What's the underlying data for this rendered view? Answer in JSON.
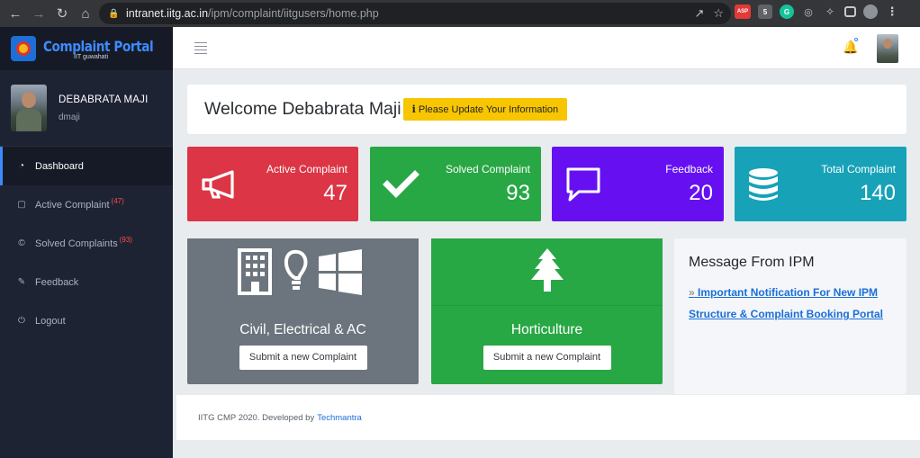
{
  "browser": {
    "url_host": "intranet.iitg.ac.in",
    "url_path": "/ipm/complaint/iitgusers/home.php",
    "extensions": [
      {
        "icon": "asp-extension-icon",
        "label": "ASP",
        "color": "#e53935"
      },
      {
        "icon": "badge-extension-icon",
        "label": "5",
        "color": "#5f6368"
      },
      {
        "icon": "grammarly-extension-icon",
        "label": "G",
        "color": "#15c39a"
      },
      {
        "icon": "dropper-extension-icon",
        "label": "",
        "color": "#5f6368"
      }
    ]
  },
  "brand": {
    "title": "Complaint Portal",
    "subtitle": "IIT guwahati"
  },
  "user": {
    "name": "DEBABRATA MAJI",
    "username": "dmaji"
  },
  "menu": [
    {
      "label": "Dashboard",
      "icon": "dashboard-icon",
      "badge": ""
    },
    {
      "label": "Active Complaint",
      "icon": "book-icon",
      "badge": "47"
    },
    {
      "label": "Solved Complaints",
      "icon": "copyright-icon",
      "badge": "93"
    },
    {
      "label": "Feedback",
      "icon": "edit-icon",
      "badge": ""
    },
    {
      "label": "Logout",
      "icon": "power-icon",
      "badge": ""
    }
  ],
  "welcome": {
    "text": "Welcome Debabrata Maji",
    "update_label": "Please Update Your Information"
  },
  "stats": [
    {
      "label": "Active Complaint",
      "value": "47",
      "icon": "megaphone-icon",
      "color": "#dc3545"
    },
    {
      "label": "Solved Complaint",
      "value": "93",
      "icon": "check-icon",
      "color": "#28a745"
    },
    {
      "label": "Feedback",
      "value": "20",
      "icon": "comment-icon",
      "color": "#6610f2"
    },
    {
      "label": "Total Complaint",
      "value": "140",
      "icon": "database-icon",
      "color": "#17a2b8"
    }
  ],
  "categories": [
    {
      "title": "Civil, Electrical & AC",
      "button": "Submit a new Complaint"
    },
    {
      "title": "Horticulture",
      "button": "Submit a new Complaint"
    }
  ],
  "message": {
    "title": "Message From IPM",
    "link_line1": "Important Notification For New IPM",
    "link_line2": "Structure & Complaint Booking Portal"
  },
  "footer": {
    "text": "IITG CMP 2020. Developed by",
    "link": "Techmantra"
  }
}
